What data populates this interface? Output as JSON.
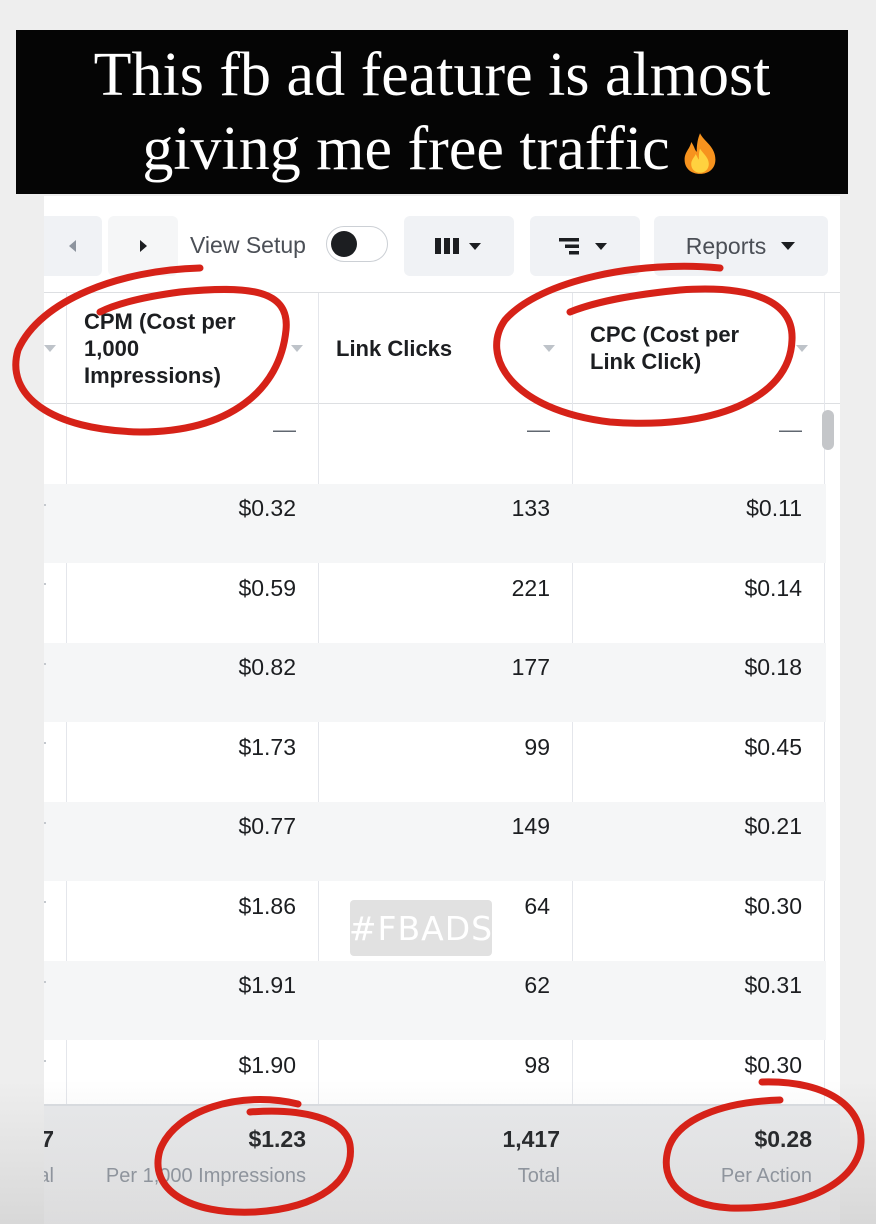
{
  "caption": {
    "line1": "This fb ad feature is almost",
    "line2": "giving me free traffic"
  },
  "toolbar": {
    "prev_icon": "chevron-left-icon",
    "next_icon": "chevron-right-icon",
    "view_setup_label": "View Setup",
    "view_setup_on": false,
    "columns_icon": "columns-icon",
    "breakdown_icon": "breakdown-icon",
    "reports_label": "Reports"
  },
  "table": {
    "columns": [
      {
        "label_lines": [
          "CPM (Cost per",
          "1,000",
          "Impressions)"
        ]
      },
      {
        "label_lines": [
          "Link Clicks"
        ]
      },
      {
        "label_lines": [
          "CPC (Cost per",
          "Link Click)"
        ]
      }
    ],
    "rows": [
      {
        "cpm": "—",
        "clicks": "—",
        "cpc": "—"
      },
      {
        "cpm": "$0.32",
        "clicks": "133",
        "cpc": "$0.11"
      },
      {
        "cpm": "$0.59",
        "clicks": "221",
        "cpc": "$0.14"
      },
      {
        "cpm": "$0.82",
        "clicks": "177",
        "cpc": "$0.18"
      },
      {
        "cpm": "$1.73",
        "clicks": "99",
        "cpc": "$0.45"
      },
      {
        "cpm": "$0.77",
        "clicks": "149",
        "cpc": "$0.21"
      },
      {
        "cpm": "$1.86",
        "clicks": "64",
        "cpc": "$0.30"
      },
      {
        "cpm": "$1.91",
        "clicks": "62",
        "cpc": "$0.31"
      },
      {
        "cpm": "$1.90",
        "clicks": "98",
        "cpc": "$0.30"
      }
    ],
    "footer": {
      "left_partial": "7",
      "left_partial_sub": "al",
      "cpm": "$1.23",
      "cpm_sub": "Per 1,000 Impressions",
      "clicks": "1,417",
      "clicks_sub": "Total",
      "cpc": "$0.28",
      "cpc_sub": "Per Action"
    }
  },
  "hashtag": "#FBADS",
  "annotation_color": "#d62218"
}
